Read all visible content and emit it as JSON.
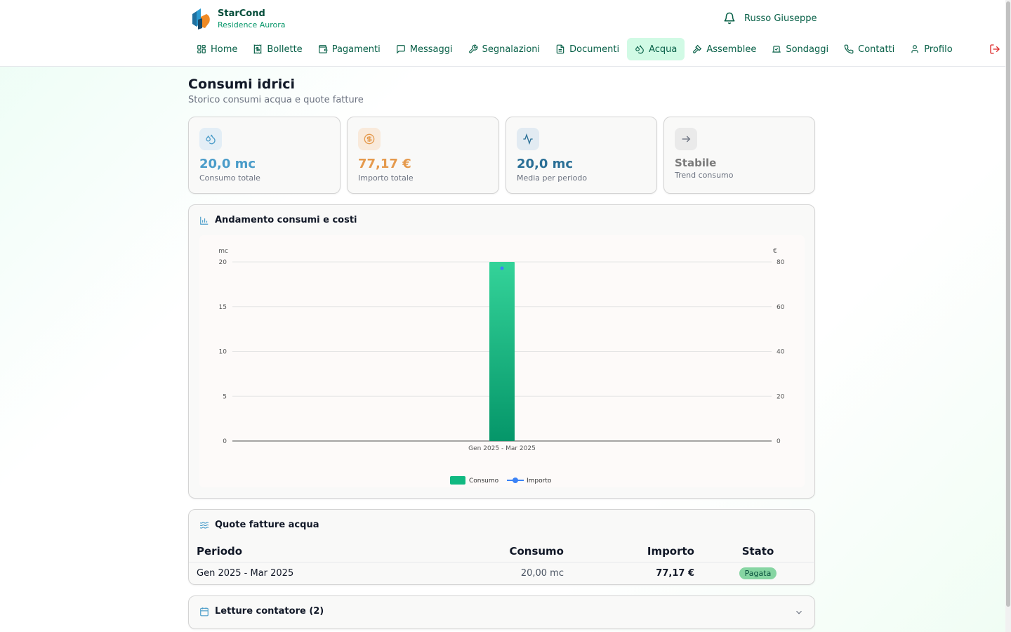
{
  "brand": {
    "name": "StarCond",
    "subtitle": "Residence Aurora"
  },
  "user": {
    "name": "Russo Giuseppe"
  },
  "nav": [
    {
      "label": "Home",
      "icon": "home-icon"
    },
    {
      "label": "Bollette",
      "icon": "receipt-icon"
    },
    {
      "label": "Pagamenti",
      "icon": "wallet-icon"
    },
    {
      "label": "Messaggi",
      "icon": "message-icon"
    },
    {
      "label": "Segnalazioni",
      "icon": "wrench-icon"
    },
    {
      "label": "Documenti",
      "icon": "document-icon"
    },
    {
      "label": "Acqua",
      "icon": "droplets-icon",
      "active": true
    },
    {
      "label": "Assemblee",
      "icon": "gavel-icon"
    },
    {
      "label": "Sondaggi",
      "icon": "vote-icon"
    },
    {
      "label": "Contatti",
      "icon": "phone-icon"
    },
    {
      "label": "Profilo",
      "icon": "user-icon"
    }
  ],
  "page": {
    "title": "Consumi idrici",
    "subtitle": "Storico consumi acqua e quote fatture"
  },
  "stats": [
    {
      "value": "20,0 mc",
      "label": "Consumo totale",
      "color": "#4a9cc9",
      "icon": "droplets-icon"
    },
    {
      "value": "77,17 €",
      "label": "Importo totale",
      "color": "#e59a4d",
      "icon": "dollar-icon"
    },
    {
      "value": "20,0 mc",
      "label": "Media per periodo",
      "color": "#2a6f96",
      "icon": "activity-icon"
    },
    {
      "value": "Stabile",
      "label": "Trend consumo",
      "color": "#7a7a7a",
      "icon": "arrow-right-icon"
    }
  ],
  "chart_section": {
    "title": "Andamento consumi e costi"
  },
  "chart_data": {
    "type": "bar",
    "categories": [
      "Gen 2025 - Mar 2025"
    ],
    "series": [
      {
        "name": "Consumo",
        "values": [
          20
        ],
        "axis": "left",
        "kind": "bar",
        "color": "#10b981"
      },
      {
        "name": "Importo",
        "values": [
          77.17
        ],
        "axis": "right",
        "kind": "line",
        "color": "#3b82f6"
      }
    ],
    "y_left_label": "mc",
    "y_right_label": "€",
    "ylim_left": [
      0,
      20
    ],
    "ylim_right": [
      0,
      80
    ],
    "y_left_ticks": [
      0,
      5,
      10,
      15,
      20
    ],
    "y_right_ticks": [
      0,
      20,
      40,
      60,
      80
    ],
    "grid": true,
    "legend_position": "bottom"
  },
  "invoices": {
    "title": "Quote fatture acqua",
    "headers": {
      "period": "Periodo",
      "consumption": "Consumo",
      "amount": "Importo",
      "status": "Stato"
    },
    "rows": [
      {
        "period": "Gen 2025 - Mar 2025",
        "consumption": "20,00 mc",
        "amount": "77,17 €",
        "status": "Pagata"
      }
    ]
  },
  "readings": {
    "title": "Letture contatore (2)"
  }
}
